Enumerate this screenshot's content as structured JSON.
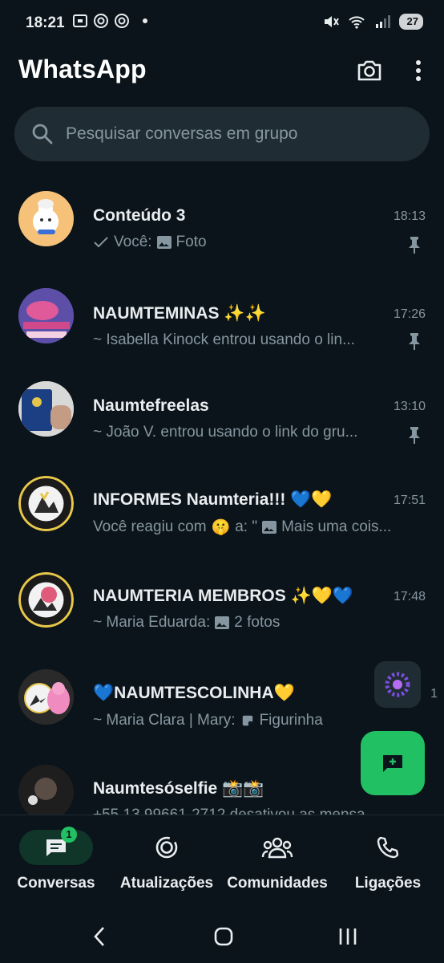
{
  "status_bar": {
    "time": "18:21",
    "battery": "27"
  },
  "app": {
    "title": "WhatsApp"
  },
  "search": {
    "placeholder": "Pesquisar conversas em grupo"
  },
  "chats": [
    {
      "name": "Conteúdo 3",
      "time": "18:13",
      "prefix": "Você:",
      "preview": "Foto",
      "pinned": true,
      "status_check": true,
      "media_icon": "image-icon"
    },
    {
      "name": "NAUMTEMINAS ✨✨",
      "time": "17:26",
      "preview": "~ Isabella Kinock entrou usando o lin...",
      "pinned": true
    },
    {
      "name": "Naumtefreelas",
      "time": "13:10",
      "preview": "~ João V. entrou usando o link do gru...",
      "pinned": true
    },
    {
      "name": "INFORMES Naumteria!!! 💙💛",
      "time": "17:51",
      "preview_part1": "Você reagiu com",
      "reaction": "🤫",
      "preview_part2": "a: \"",
      "preview_part3": "Mais uma cois...",
      "media_icon": "image-icon"
    },
    {
      "name": "NAUMTERIA MEMBROS ✨💛💙",
      "time": "17:48",
      "prefix": "~ Maria Eduarda:",
      "preview": "2 fotos",
      "media_icon": "image-icon"
    },
    {
      "name": "💙NAUMTESCOLINHA💛",
      "time": "1",
      "prefix": "~ Maria Clara | Mary:",
      "preview": "Figurinha",
      "media_icon": "sticker-icon"
    },
    {
      "name": "Naumtesóselfie 📸📸",
      "time": "",
      "preview": "+55 13 99661-2712 desativou as mensa..."
    }
  ],
  "bottom_nav": {
    "items": [
      {
        "label": "Conversas",
        "icon": "chats-icon",
        "active": true,
        "badge": "1"
      },
      {
        "label": "Atualizações",
        "icon": "updates-icon",
        "active": false
      },
      {
        "label": "Comunidades",
        "icon": "communities-icon",
        "active": false
      },
      {
        "label": "Ligações",
        "icon": "calls-icon",
        "active": false
      }
    ]
  },
  "colors": {
    "background": "#0b141a",
    "accent": "#21c063",
    "search_bg": "#202c33",
    "muted_text": "#8696a0"
  }
}
